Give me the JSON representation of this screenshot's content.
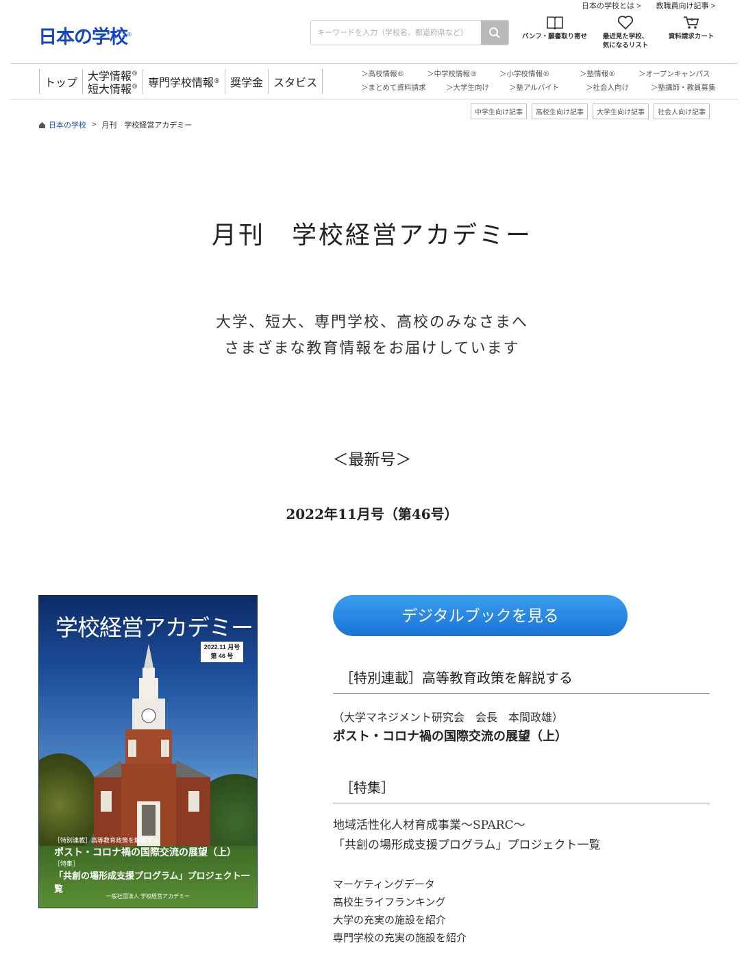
{
  "header": {
    "util_links": [
      "日本の学校とは >",
      "教職員向け記事 >"
    ],
    "logo_text": "日本の学校",
    "logo_mark": "®",
    "search_placeholder": "キーワードを入力（学校名、都道府県など）",
    "icons": [
      {
        "name": "book-icon",
        "label1": "パンフ・願書取り寄せ",
        "label2": ""
      },
      {
        "name": "heart-icon",
        "label1": "最近見た学校、",
        "label2": "気になるリスト"
      },
      {
        "name": "cart-icon",
        "label1": "資料請求カート",
        "label2": ""
      }
    ]
  },
  "nav": {
    "main": [
      "トップ",
      "大学情報",
      "短大情報",
      "専門学校情報",
      "奨学金",
      "スタビス"
    ],
    "reg": "®",
    "sub_row1": [
      "＞高校情報®",
      "＞中学校情報®",
      "＞小学校情報®",
      "＞塾情報®",
      "＞オープンキャンパス"
    ],
    "sub_row2": [
      "＞まとめて資料請求",
      "＞大学生向け",
      "＞塾アルバイト",
      "＞社会人向け",
      "＞塾講師・教員募集"
    ],
    "tags": [
      "中学生向け記事",
      "高校生向け記事",
      "大学生向け記事",
      "社会人向け記事"
    ]
  },
  "breadcrumb": {
    "home": "日本の学校",
    "sep": ">",
    "current": "月刊　学校経営アカデミー"
  },
  "page": {
    "title": "月刊　学校経営アカデミー",
    "lead1": "大学、短大、専門学校、高校のみなさまへ",
    "lead2": "さまざまな教育情報をお届けしています",
    "latest": "＜最新号＞",
    "issue": "2022年11月号（第46号）"
  },
  "cover": {
    "title": "学校経営アカデミー",
    "badge1": "2022.11 月号",
    "badge2": "第 46 号",
    "line1": "［特別連載］高等教育政策を解説する",
    "line2": "ポスト・コロナ禍の国際交流の展望（上）",
    "line3": "［特集］",
    "line4": "「共創の場形成支援プログラム」プロジェクト一覧",
    "publisher": "一般社団法人 学校経営アカデミー"
  },
  "content": {
    "digital_button": "デジタルブックを見る",
    "sec1_heading": "［特別連載］高等教育政策を解説する",
    "sec1_author": "（大学マネジメント研究会　会長　本間政雄）",
    "sec1_title": "ポスト・コロナ禍の国際交流の展望（上）",
    "sec2_heading": "［特集］",
    "sec2_line1": "地域活性化人材育成事業～SPARC～",
    "sec2_line2": "「共創の場形成支援プログラム」プロジェクト一覧",
    "more": [
      "マーケティングデータ",
      "高校生ライフランキング",
      "大学の充実の施設を紹介",
      "専門学校の充実の施設を紹介"
    ]
  },
  "colors": {
    "brand": "#1446c7",
    "button": "#2a86e0"
  }
}
